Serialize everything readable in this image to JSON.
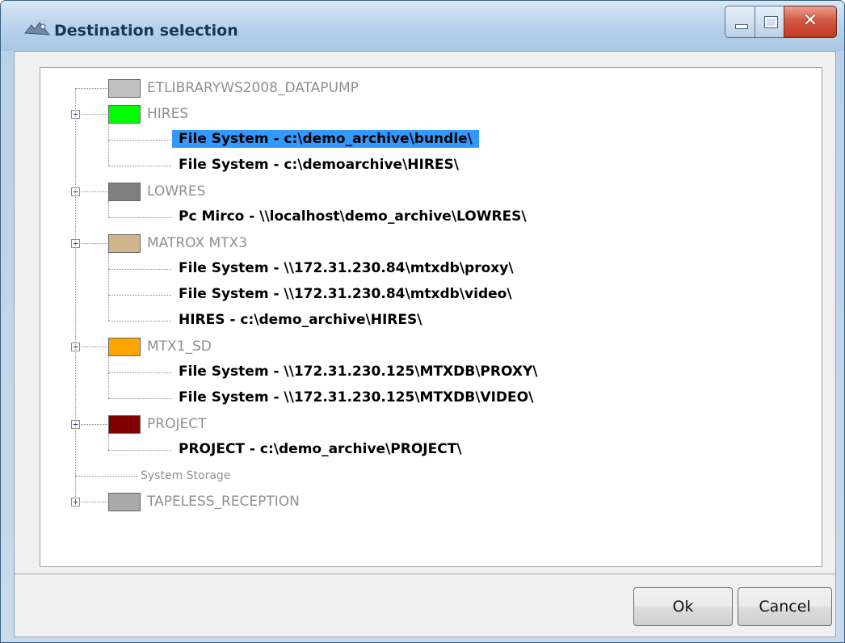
{
  "window": {
    "title": "Destination selection",
    "close_glyph": "✕"
  },
  "tree": {
    "groups": [
      {
        "label": "ETLIBRARYWS2008_DATAPUMP",
        "color": "#c0c0c0"
      },
      {
        "label": "HIRES",
        "color": "#00ff00",
        "expanded": true,
        "children": [
          "File System   -   c:\\demo_archive\\bundle\\",
          "File System   -   c:\\demoarchive\\HIRES\\"
        ]
      },
      {
        "label": "LOWRES",
        "color": "#808080",
        "expanded": true,
        "children": [
          "Pc Mirco   -   \\\\localhost\\demo_archive\\LOWRES\\"
        ]
      },
      {
        "label": "MATROX MTX3",
        "color": "#d2b48c",
        "expanded": true,
        "children": [
          "File System   -   \\\\172.31.230.84\\mtxdb\\proxy\\",
          "File System   -   \\\\172.31.230.84\\mtxdb\\video\\",
          "HIRES   -   c:\\demo_archive\\HIRES\\"
        ]
      },
      {
        "label": "MTX1_SD",
        "color": "#ffa500",
        "expanded": true,
        "children": [
          "File System   -   \\\\172.31.230.125\\MTXDB\\PROXY\\",
          "File System   -   \\\\172.31.230.125\\MTXDB\\VIDEO\\"
        ]
      },
      {
        "label": "PROJECT",
        "color": "#800000",
        "expanded": true,
        "children": [
          "PROJECT   -   c:\\demo_archive\\PROJECT\\"
        ]
      },
      {
        "label": "System Storage"
      },
      {
        "label": "TAPELESS_RECEPTION",
        "color": "#a9a9a9",
        "expanded": false
      }
    ],
    "selected": "File System   -   c:\\demo_archive\\bundle\\",
    "expander_expanded": "−",
    "expander_collapsed": "+"
  },
  "buttons": {
    "ok": "Ok",
    "cancel": "Cancel"
  }
}
